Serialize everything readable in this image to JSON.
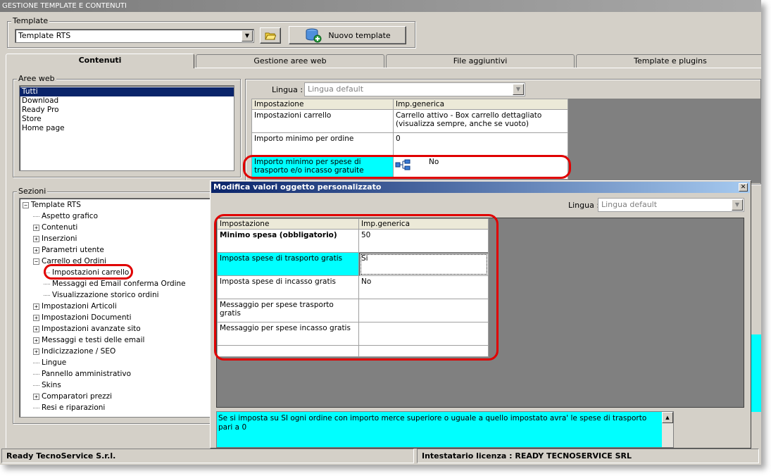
{
  "window": {
    "title": "GESTIONE TEMPLATE E CONTENUTI"
  },
  "template_group": {
    "label": "Template",
    "selected": "Template RTS",
    "open_icon": "folder-open-icon",
    "new_button": "Nuovo template"
  },
  "tabs": [
    {
      "label": "Contenuti",
      "active": true
    },
    {
      "label": "Gestione aree web",
      "active": false
    },
    {
      "label": "File aggiuntivi",
      "active": false
    },
    {
      "label": "Template e plugins",
      "active": false
    }
  ],
  "aree_web": {
    "label": "Aree web",
    "items": [
      "Tutti",
      "Download",
      "Ready Pro",
      "Store",
      "Home page"
    ],
    "selected": "Tutti"
  },
  "sezioni": {
    "label": "Sezioni",
    "items": [
      {
        "label": "Template RTS",
        "level": 0,
        "toggle": "-"
      },
      {
        "label": "Aspetto grafico",
        "level": 1,
        "toggle": ""
      },
      {
        "label": "Contenuti",
        "level": 1,
        "toggle": "+"
      },
      {
        "label": "Inserzioni",
        "level": 1,
        "toggle": "+"
      },
      {
        "label": "Parametri utente",
        "level": 1,
        "toggle": "+"
      },
      {
        "label": "Carrello ed Ordini",
        "level": 1,
        "toggle": "-"
      },
      {
        "label": "Impostazioni carrello",
        "level": 2,
        "toggle": ""
      },
      {
        "label": "Messaggi ed Email conferma Ordine",
        "level": 2,
        "toggle": ""
      },
      {
        "label": "Visualizzazione storico ordini",
        "level": 2,
        "toggle": ""
      },
      {
        "label": "Impostazioni Articoli",
        "level": 1,
        "toggle": "+"
      },
      {
        "label": "Impostazioni Documenti",
        "level": 1,
        "toggle": "+"
      },
      {
        "label": "Impostazioni avanzate sito",
        "level": 1,
        "toggle": "+"
      },
      {
        "label": "Messaggi e testi delle email",
        "level": 1,
        "toggle": "+"
      },
      {
        "label": "Indicizzazione / SEO",
        "level": 1,
        "toggle": "+"
      },
      {
        "label": "Lingue",
        "level": 1,
        "toggle": ""
      },
      {
        "label": "Pannello amministrativo",
        "level": 1,
        "toggle": ""
      },
      {
        "label": "Skins",
        "level": 1,
        "toggle": ""
      },
      {
        "label": "Comparatori prezzi",
        "level": 1,
        "toggle": "+"
      },
      {
        "label": "Resi e riparazioni",
        "level": 1,
        "toggle": ""
      }
    ]
  },
  "main_grid": {
    "lingua_label": "Lingua :",
    "lingua_value": "Lingua default",
    "headers": [
      "Impostazione",
      "Imp.generica"
    ],
    "rows": [
      {
        "key": "Impostazioni carrello",
        "value": "Carrello attivo - Box carrello dettagliato (visualizza sempre, anche se vuoto)"
      },
      {
        "key": "Importo minimo per ordine",
        "value": "0"
      },
      {
        "key": "Importo minimo per spese di trasporto e/o incasso gratuite",
        "value": "No",
        "icon": "hierarchy-icon"
      }
    ]
  },
  "dialog": {
    "title": "Modifica valori oggetto personalizzato",
    "lingua_label": "Lingua :",
    "lingua_value": "Lingua default",
    "headers": [
      "Impostazione",
      "Imp.generica"
    ],
    "rows": [
      {
        "key": "Minimo spesa (obbligatorio)",
        "value": "50"
      },
      {
        "key": "Imposta spese di trasporto gratis",
        "value": "Si"
      },
      {
        "key": "Imposta spese di incasso gratis",
        "value": "No"
      },
      {
        "key": "Messaggio per spese trasporto gratis",
        "value": ""
      },
      {
        "key": "Messaggio per spese incasso gratis",
        "value": ""
      }
    ],
    "description": "Se si imposta su SI ogni ordine con importo merce superiore o uguale a quello impostato avra' le spese di trasporto pari a 0"
  },
  "status": {
    "company": "Ready TecnoService S.r.l.",
    "license": "Intestatario licenza : READY TECNOSERVICE SRL"
  },
  "colors": {
    "highlight": "#00ffff",
    "selection": "#0a246a",
    "annotation": "#e00000"
  }
}
